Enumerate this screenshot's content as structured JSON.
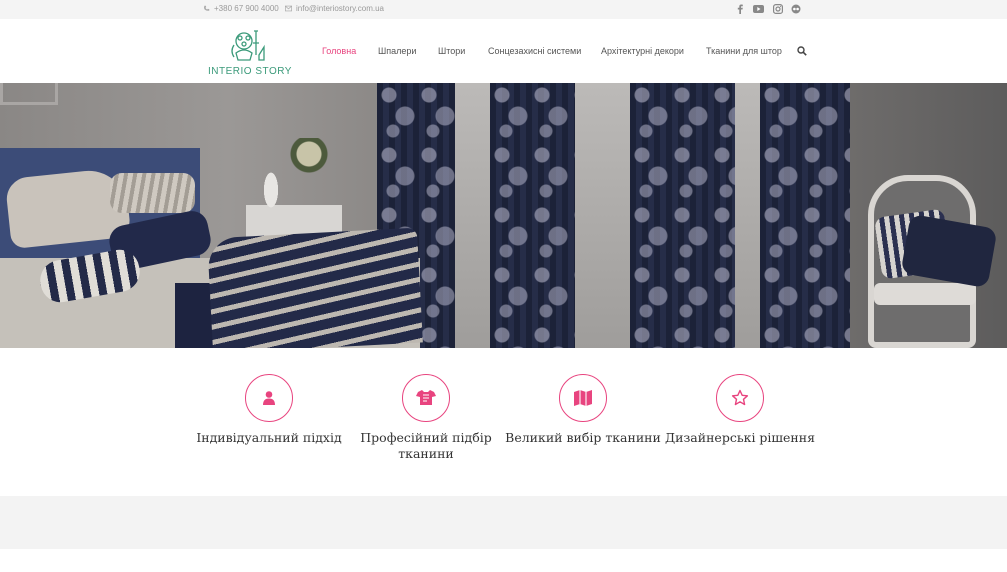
{
  "topbar": {
    "phone": "+380 67 900 4000",
    "email": "info@interiostory.com.ua",
    "phone_icon": "phone-icon",
    "email_icon": "envelope-icon",
    "social": [
      "facebook-icon",
      "youtube-icon",
      "instagram-icon",
      "tripadvisor-icon"
    ]
  },
  "header": {
    "logo_text": "INTERIO STORY",
    "nav": [
      "Головна",
      "Шпалери",
      "Штори",
      "Сонцезахисні системи",
      "Архітектурні декори",
      "Тканини для штор"
    ],
    "active_index": 0,
    "search_icon": "search-icon"
  },
  "features": [
    {
      "icon": "user-icon",
      "title": "Індивідуальний підхід"
    },
    {
      "icon": "shirt-icon",
      "title": "Професійний підбір тканини"
    },
    {
      "icon": "map-icon",
      "title": "Великий вибір тканини"
    },
    {
      "icon": "star-icon",
      "title": "Дизайнерські рішення"
    }
  ],
  "colors": {
    "accent": "#e8447f",
    "logo": "#3b9a7a",
    "topbar_bg": "#f4f4f4",
    "band_bg": "#f3f3f3"
  }
}
